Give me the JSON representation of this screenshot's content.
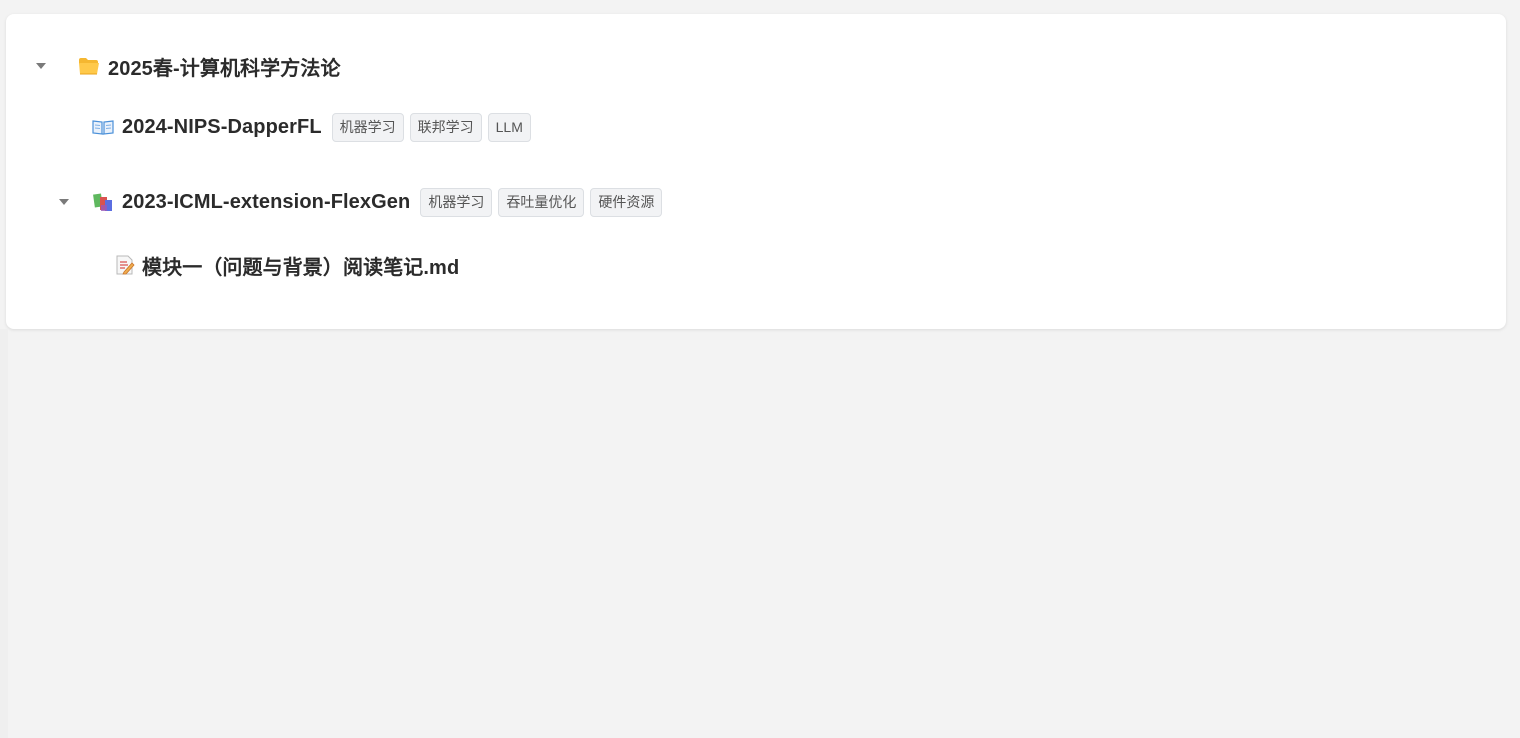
{
  "tree": {
    "folder": {
      "title": "2025春-计算机科学方法论",
      "icon": "open-folder-icon",
      "expanded": true
    },
    "items": [
      {
        "title": "2024-NIPS-DapperFL",
        "icon": "open-book-icon",
        "tags": [
          "机器学习",
          "联邦学习",
          "LLM"
        ]
      },
      {
        "title": "2023-ICML-extension-FlexGen",
        "icon": "books-stack-icon",
        "expanded": true,
        "tags": [
          "机器学习",
          "吞吐量优化",
          "硬件资源"
        ],
        "children": [
          {
            "title": "模块一（问题与背景）阅读笔记.md",
            "icon": "memo-icon"
          }
        ]
      }
    ]
  },
  "colors": {
    "background": "#f3f3f3",
    "card": "#ffffff",
    "tag_bg": "#f2f3f5",
    "tag_border": "#dcdfe3",
    "title": "#2b2b2b"
  }
}
